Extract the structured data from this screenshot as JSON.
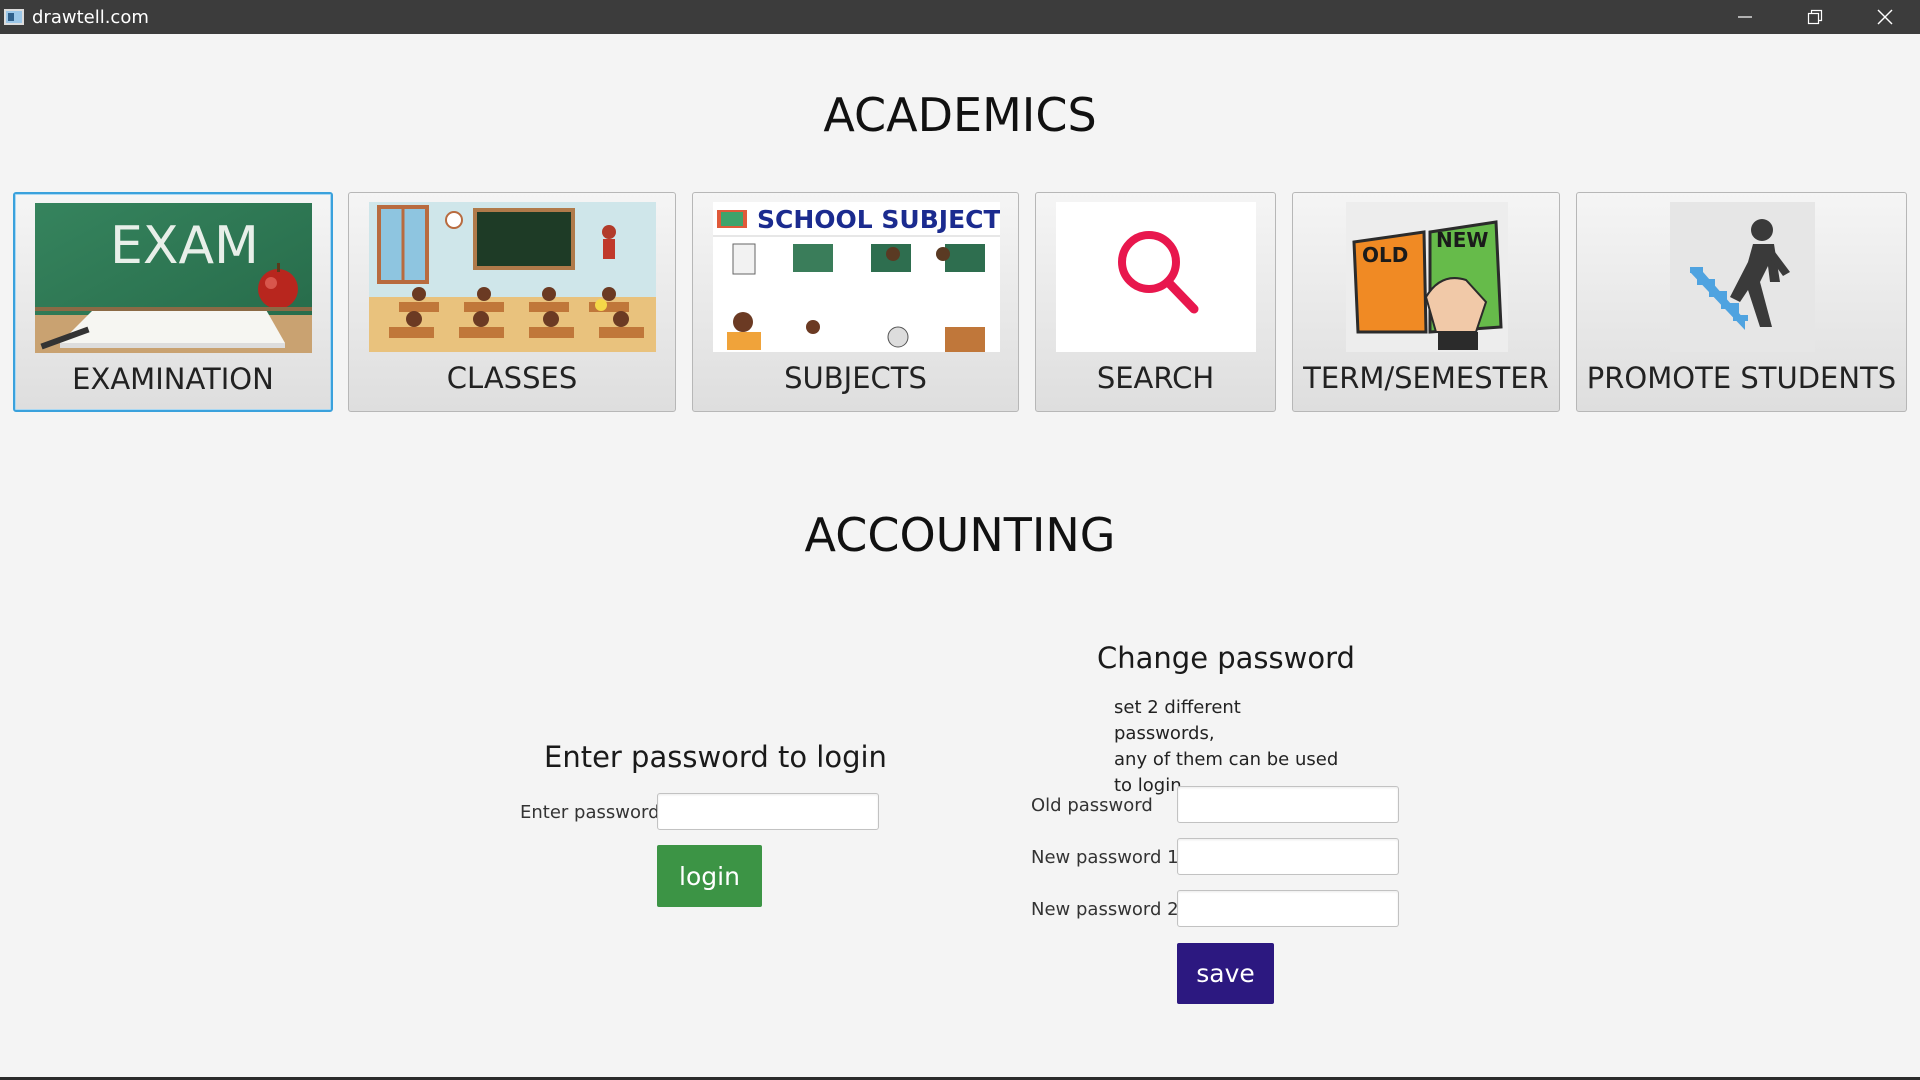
{
  "window": {
    "title": "drawtell.com",
    "controls": [
      "minimize-icon",
      "restore-icon",
      "close-icon"
    ]
  },
  "academics": {
    "heading": "ACADEMICS",
    "tiles": [
      {
        "label": "EXAMINATION",
        "icon": "exam-chalkboard-image",
        "selected": true
      },
      {
        "label": "CLASSES",
        "icon": "classroom-image",
        "selected": false
      },
      {
        "label": "SUBJECTS",
        "icon": "school-subjects-image",
        "selected": false,
        "image_text": "SCHOOL SUBJECTS"
      },
      {
        "label": "SEARCH",
        "icon": "magnifier-icon",
        "selected": false
      },
      {
        "label": "TERM/SEMESTER",
        "icon": "old-new-book-image",
        "selected": false,
        "image_text": [
          "OLD",
          "NEW"
        ]
      },
      {
        "label": "PROMOTE STUDENTS",
        "icon": "person-climbing-stairs-icon",
        "selected": false
      }
    ],
    "exam_image_text": "EXAM"
  },
  "accounting": {
    "heading": "ACCOUNTING"
  },
  "login": {
    "heading": "Enter password to login",
    "password_label": "Enter password",
    "password_value": "",
    "button_label": "login"
  },
  "change_password": {
    "heading": "Change password",
    "hint_lines": [
      "set 2 different passwords,",
      "any of them can be used",
      "to login"
    ],
    "old_label": "Old password",
    "new1_label": "New password 1",
    "new2_label": "New password 2",
    "old_value": "",
    "new1_value": "",
    "new2_value": "",
    "button_label": "save"
  },
  "colors": {
    "titlebar": "#3c3c3c",
    "background": "#f4f4f4",
    "login_button": "#3c9445",
    "save_button": "#2c1880",
    "selected_border": "#3aa1dc"
  }
}
